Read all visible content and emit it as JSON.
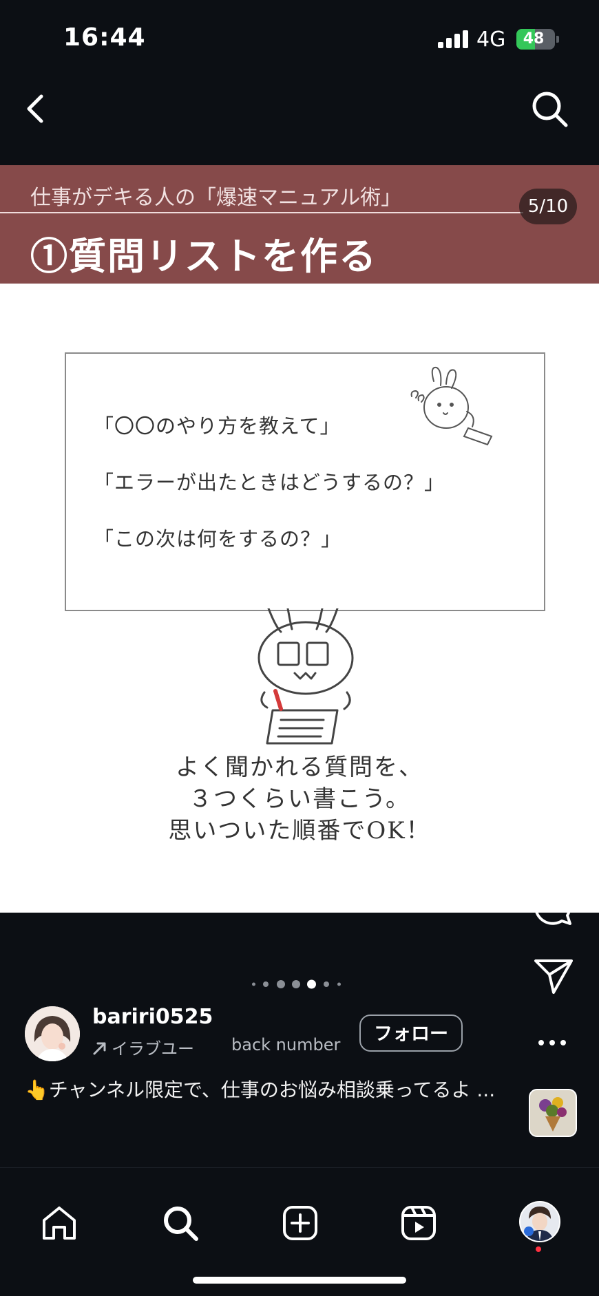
{
  "status_bar": {
    "time": "16:44",
    "network": "4G",
    "battery": "48"
  },
  "post": {
    "banner_subtitle": "仕事がデキる人の「爆速マニュアル術」",
    "banner_title": "①質問リストを作る",
    "page_indicator": "5/10",
    "questions": [
      "「〇〇のやり方を教えて」",
      "「エラーが出たときはどうするの？」",
      "「この次は何をするの？」"
    ],
    "caption_lines": [
      "よく聞かれる質問を、",
      "３つくらい書こう。",
      "思いついた順番でOK！"
    ]
  },
  "carousel": {
    "total": 7,
    "active": 4
  },
  "actions": {
    "like_count": ""
  },
  "author": {
    "username": "bariri0525",
    "audio_label": "イラブユー",
    "audio_song": "back number",
    "follow_label": "フォロー"
  },
  "description": "👆チャンネル限定で、仕事のお悩み相談乗ってるよ ...",
  "icons": {
    "back": "chevron-left-icon",
    "search": "search-icon",
    "like": "heart-icon",
    "comment": "comment-icon",
    "share": "send-icon",
    "more": "more-icon",
    "home": "home-icon",
    "create": "plus-square-icon",
    "reels": "reels-icon"
  },
  "colors": {
    "background": "#0c0f14",
    "banner": "#864a4a",
    "notification": "#ff3040"
  }
}
